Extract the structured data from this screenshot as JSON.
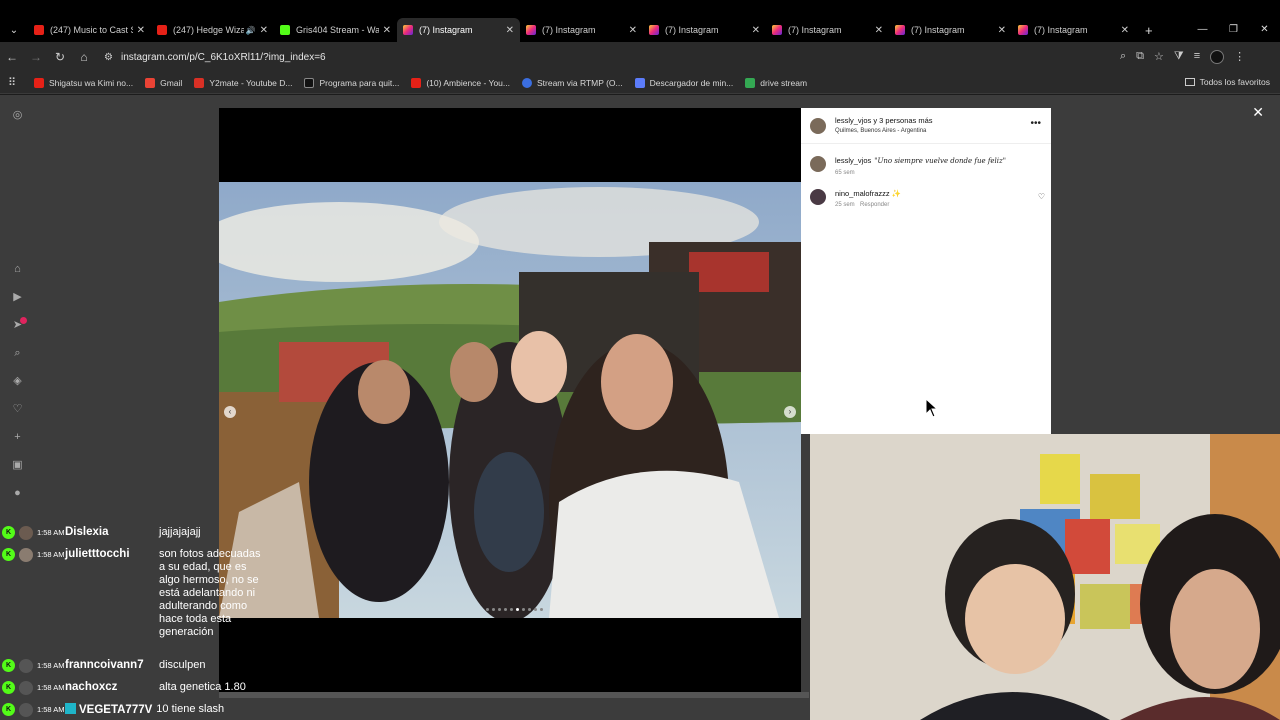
{
  "browser": {
    "tabs": [
      {
        "title": "(247) Music to Cast S",
        "icon": "youtube-icon",
        "active": false
      },
      {
        "title": "(247) Hedge Wiza",
        "icon": "youtube-icon",
        "active": false,
        "audio": true
      },
      {
        "title": "Gris404 Stream - Wa",
        "icon": "kick-icon",
        "active": false
      },
      {
        "title": "(7) Instagram",
        "icon": "instagram-icon",
        "active": true
      },
      {
        "title": "(7) Instagram",
        "icon": "instagram-icon",
        "active": false
      },
      {
        "title": "(7) Instagram",
        "icon": "instagram-icon",
        "active": false
      },
      {
        "title": "(7) Instagram",
        "icon": "instagram-icon",
        "active": false
      },
      {
        "title": "(7) Instagram",
        "icon": "instagram-icon",
        "active": false
      },
      {
        "title": "(7) Instagram",
        "icon": "instagram-icon",
        "active": false
      }
    ],
    "url": "instagram.com/p/C_6K1oXRl11/?img_index=6",
    "bookmarks": [
      {
        "label": "Shigatsu wa Kimi no...",
        "color": "#e62117"
      },
      {
        "label": "Gmail",
        "color": "#ea4335"
      },
      {
        "label": "Y2mate - Youtube D...",
        "color": "#d93025"
      },
      {
        "label": "Programa para quit...",
        "color": "#222222"
      },
      {
        "label": "(10) Ambience - You...",
        "color": "#e62117"
      },
      {
        "label": "Stream via RTMP (O...",
        "color": "#3b6ee0"
      },
      {
        "label": "Descargador de min...",
        "color": "#5c7cfa"
      },
      {
        "label": "drive stream",
        "color": "#34a853"
      }
    ],
    "all_bookmarks": "Todos los favoritos"
  },
  "post": {
    "header_user": "lessly_vjos y 3 personas más",
    "location": "Quilmes, Buenos Aires - Argentina",
    "comments": [
      {
        "user": "lessly_vjos",
        "text": "\"Uno siempre vuelve donde fue feliz\"",
        "age": "65 sem",
        "reply": ""
      },
      {
        "user": "nino_malofrazzz",
        "text": "✨",
        "age": "25 sem",
        "reply": "Responder"
      }
    ],
    "carousel_total": 10,
    "carousel_active": 6
  },
  "chat": [
    {
      "time": "1:58 AM",
      "user": "Dislexia",
      "text": "jajjajajajj"
    },
    {
      "time": "1:58 AM",
      "user": "julietttocchi",
      "text": "son fotos adecuadas a su edad, que es algo hermoso, no se está adelantando ni adulterando como hace toda esta generación"
    },
    {
      "time": "1:58 AM",
      "user": "franncoivann7",
      "text": "disculpen"
    },
    {
      "time": "1:58 AM",
      "user": "nachoxcz",
      "text": "alta genetica 1.80"
    },
    {
      "time": "1:58 AM",
      "user": "VEGETA777V",
      "text": "10 tiene slash"
    }
  ]
}
